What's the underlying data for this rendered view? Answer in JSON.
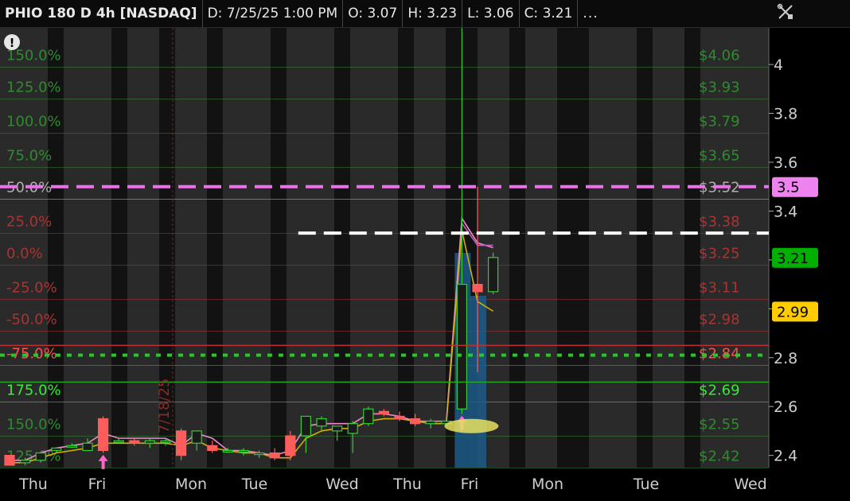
{
  "header": {
    "symbol": "PHIO 180 D 4h [NASDAQ]",
    "date": "D: 7/25/25 1:00 PM",
    "open": "O: 3.07",
    "high": "H: 3.23",
    "low": "L: 3.06",
    "close": "C: 3.21",
    "more": "..."
  },
  "icons": {
    "settings": "crossed-tools-icon",
    "alert": "exclamation-icon"
  },
  "chart_data": {
    "type": "candlestick",
    "ylim": [
      2.35,
      4.15
    ],
    "y_ticks": [
      2.4,
      2.6,
      2.8,
      3.0,
      3.2,
      3.4,
      3.6,
      3.8,
      4.0
    ],
    "y_tick_labels": [
      "2.4",
      "2.6",
      "2.8",
      "3.6",
      "3.8",
      "4"
    ],
    "x_labels": [
      "Thu",
      "Fri",
      "Mon",
      "Tue",
      "Wed",
      "Thu",
      "Fri",
      "Mon",
      "Tue",
      "Wed"
    ],
    "rotated_date_label": "7/18/25",
    "price_markers": [
      {
        "label": "3.5",
        "value": 3.5,
        "color": "#ee82ee"
      },
      {
        "label": "3.21",
        "value": 3.21,
        "color": "#00b000"
      },
      {
        "label": "2.99",
        "value": 2.99,
        "color": "#ffcc00"
      }
    ],
    "fib_left_labels": [
      {
        "label": "150.0%",
        "value": 4.06,
        "color": "#2e8b2e"
      },
      {
        "label": "125.0%",
        "value": 3.93,
        "color": "#2e8b2e"
      },
      {
        "label": "100.0%",
        "value": 3.79,
        "color": "#2e8b2e"
      },
      {
        "label": "75.0%",
        "value": 3.65,
        "color": "#2e8b2e"
      },
      {
        "label": "50.0%",
        "value": 3.52,
        "color": "#b0b0b0"
      },
      {
        "label": "25.0%",
        "value": 3.38,
        "color": "#a33"
      },
      {
        "label": "0.0%",
        "value": 3.25,
        "color": "#a33"
      },
      {
        "label": "-25.0%",
        "value": 3.11,
        "color": "#a33"
      },
      {
        "label": "-50.0%",
        "value": 2.98,
        "color": "#a33"
      },
      {
        "label": "-75.0%",
        "value": 2.84,
        "color": "#ff5050"
      },
      {
        "label": "175.0%",
        "value": 2.69,
        "color": "#33ee33"
      },
      {
        "label": "150.0%",
        "value": 2.55,
        "color": "#2e8b2e"
      },
      {
        "label": "125.0%",
        "value": 2.42,
        "color": "#2e8b2e"
      }
    ],
    "fib_right_labels": [
      {
        "label": "$4.06",
        "value": 4.06,
        "color": "#2e8b2e"
      },
      {
        "label": "$3.93",
        "value": 3.93,
        "color": "#2e8b2e"
      },
      {
        "label": "$3.79",
        "value": 3.79,
        "color": "#2e8b2e"
      },
      {
        "label": "$3.65",
        "value": 3.65,
        "color": "#2e8b2e"
      },
      {
        "label": "$3.52",
        "value": 3.52,
        "color": "#b0b0b0"
      },
      {
        "label": "$3.38",
        "value": 3.38,
        "color": "#a33"
      },
      {
        "label": "$3.25",
        "value": 3.25,
        "color": "#a33"
      },
      {
        "label": "$3.11",
        "value": 3.11,
        "color": "#a33"
      },
      {
        "label": "$2.98",
        "value": 2.98,
        "color": "#a33"
      },
      {
        "label": "$2.84",
        "value": 2.84,
        "color": "#ff5050"
      },
      {
        "label": "$2.69",
        "value": 2.69,
        "color": "#33ee33"
      },
      {
        "label": "$2.55",
        "value": 2.55,
        "color": "#2e8b2e"
      },
      {
        "label": "$2.42",
        "value": 2.42,
        "color": "#2e8b2e"
      }
    ],
    "horizontal_lines": [
      {
        "value": 3.5,
        "style": "dashed",
        "color": "#ee70ee"
      },
      {
        "value": 3.31,
        "style": "dashed",
        "color": "#ffffff",
        "from_x": 18
      },
      {
        "value": 2.81,
        "style": "dotted",
        "color": "#22cc22"
      },
      {
        "value": 2.85,
        "style": "solid",
        "color": "#c03030"
      },
      {
        "value": 2.7,
        "style": "solid",
        "color": "#22aa22"
      }
    ],
    "candles": [
      {
        "o": 2.4,
        "h": 2.4,
        "l": 2.36,
        "c": 2.36
      },
      {
        "o": 2.37,
        "h": 2.39,
        "l": 2.36,
        "c": 2.38
      },
      {
        "o": 2.38,
        "h": 2.41,
        "l": 2.37,
        "c": 2.41
      },
      {
        "o": 2.42,
        "h": 2.43,
        "l": 2.41,
        "c": 2.43
      },
      {
        "o": 2.44,
        "h": 2.45,
        "l": 2.43,
        "c": 2.44
      },
      {
        "o": 2.42,
        "h": 2.47,
        "l": 2.42,
        "c": 2.45
      },
      {
        "o": 2.55,
        "h": 2.56,
        "l": 2.41,
        "c": 2.42
      },
      {
        "o": 2.46,
        "h": 2.47,
        "l": 2.45,
        "c": 2.46
      },
      {
        "o": 2.46,
        "h": 2.47,
        "l": 2.44,
        "c": 2.45
      },
      {
        "o": 2.45,
        "h": 2.47,
        "l": 2.43,
        "c": 2.46
      },
      {
        "o": 2.46,
        "h": 2.47,
        "l": 2.44,
        "c": 2.46
      },
      {
        "o": 2.5,
        "h": 2.51,
        "l": 2.38,
        "c": 2.4
      },
      {
        "o": 2.45,
        "h": 2.5,
        "l": 2.42,
        "c": 2.5
      },
      {
        "o": 2.44,
        "h": 2.46,
        "l": 2.41,
        "c": 2.42
      },
      {
        "o": 2.42,
        "h": 2.43,
        "l": 2.41,
        "c": 2.42
      },
      {
        "o": 2.42,
        "h": 2.43,
        "l": 2.4,
        "c": 2.42
      },
      {
        "o": 2.41,
        "h": 2.42,
        "l": 2.39,
        "c": 2.41
      },
      {
        "o": 2.41,
        "h": 2.43,
        "l": 2.38,
        "c": 2.39
      },
      {
        "o": 2.48,
        "h": 2.5,
        "l": 2.38,
        "c": 2.4
      },
      {
        "o": 2.48,
        "h": 2.56,
        "l": 2.41,
        "c": 2.56
      },
      {
        "o": 2.52,
        "h": 2.56,
        "l": 2.5,
        "c": 2.55
      },
      {
        "o": 2.5,
        "h": 2.52,
        "l": 2.46,
        "c": 2.52
      },
      {
        "o": 2.49,
        "h": 2.54,
        "l": 2.41,
        "c": 2.53
      },
      {
        "o": 2.53,
        "h": 2.6,
        "l": 2.52,
        "c": 2.59
      },
      {
        "o": 2.58,
        "h": 2.59,
        "l": 2.56,
        "c": 2.57
      },
      {
        "o": 2.56,
        "h": 2.58,
        "l": 2.54,
        "c": 2.55
      },
      {
        "o": 2.55,
        "h": 2.57,
        "l": 2.52,
        "c": 2.53
      },
      {
        "o": 2.53,
        "h": 2.55,
        "l": 2.51,
        "c": 2.54
      },
      {
        "o": 2.53,
        "h": 2.55,
        "l": 2.52,
        "c": 2.54
      },
      {
        "o": 2.59,
        "h": 4.15,
        "l": 2.57,
        "c": 3.1
      },
      {
        "o": 3.1,
        "h": 3.5,
        "l": 2.74,
        "c": 3.07
      },
      {
        "o": 3.07,
        "h": 3.23,
        "l": 3.06,
        "c": 3.21
      }
    ],
    "volume": [
      {
        "index": 29,
        "value": 1.0
      },
      {
        "index": 30,
        "value": 0.8
      }
    ],
    "series": [
      {
        "name": "",
        "color": "#ee88cc",
        "values": [
          2.38,
          2.38,
          2.41,
          2.43,
          2.44,
          2.45,
          2.49,
          2.47,
          2.47,
          2.47,
          2.47,
          2.44,
          2.49,
          2.47,
          2.42,
          2.42,
          2.41,
          2.4,
          2.42,
          2.52,
          2.53,
          2.53,
          2.53,
          2.57,
          2.57,
          2.56,
          2.54,
          2.54,
          2.54,
          3.37,
          3.27,
          3.25
        ]
      },
      {
        "name": "",
        "color": "#d4b000",
        "values": [
          2.37,
          2.37,
          2.39,
          2.41,
          2.42,
          2.43,
          2.45,
          2.45,
          2.45,
          2.45,
          2.45,
          2.44,
          2.46,
          2.43,
          2.42,
          2.41,
          2.41,
          2.39,
          2.39,
          2.47,
          2.5,
          2.51,
          2.51,
          2.54,
          2.55,
          2.55,
          2.54,
          2.53,
          2.53,
          3.32,
          3.03,
          2.99
        ]
      },
      {
        "name": "",
        "color": "#c060c0",
        "values": [
          null,
          null,
          null,
          null,
          null,
          null,
          null,
          null,
          null,
          null,
          null,
          null,
          null,
          null,
          null,
          null,
          null,
          null,
          null,
          null,
          null,
          null,
          null,
          null,
          null,
          null,
          null,
          null,
          null,
          3.35,
          3.26,
          3.26
        ]
      }
    ],
    "markers": [
      {
        "type": "up-arrow",
        "index": 6,
        "value": 2.37,
        "color": "#ff66cc"
      },
      {
        "type": "up-arrow",
        "index": 29,
        "value": 2.53,
        "color": "#ff66cc"
      },
      {
        "type": "highlight-ellipse",
        "index": 29,
        "value": 2.52,
        "color": "#e8e060"
      }
    ]
  }
}
